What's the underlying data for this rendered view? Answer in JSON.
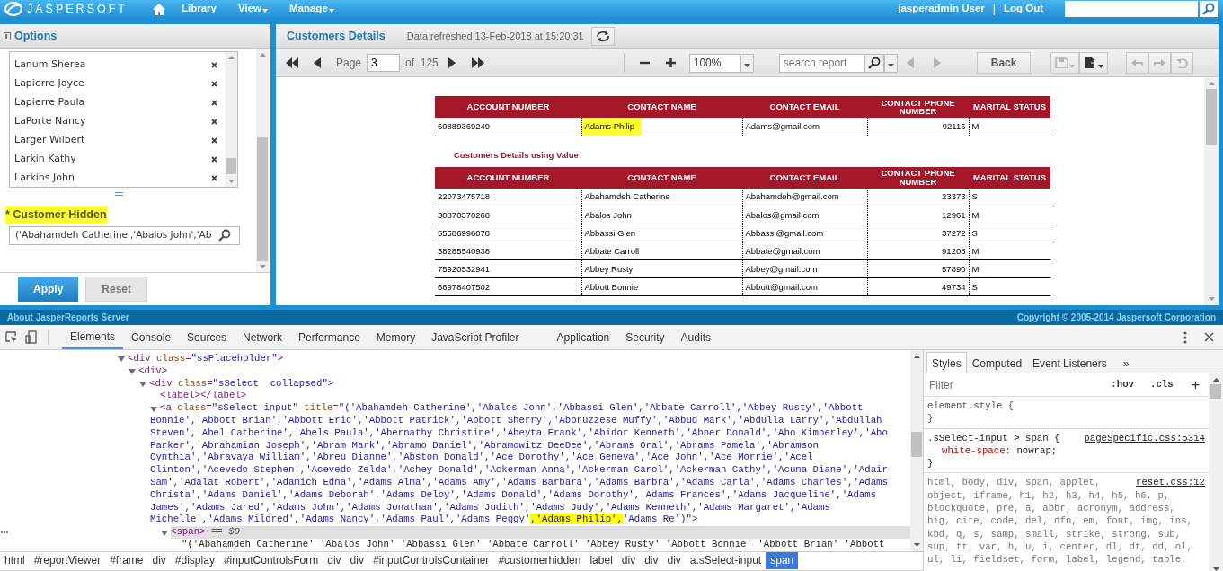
{
  "top_bar": {
    "brand": "JASPERSOFT",
    "menu": [
      {
        "label": "Library",
        "dropdown": false
      },
      {
        "label": "View",
        "dropdown": true
      },
      {
        "label": "Manage",
        "dropdown": true
      }
    ],
    "user": "jasperadmin User",
    "separator": "|",
    "logout": "Log Out"
  },
  "options_panel": {
    "title": "Options",
    "items": [
      "Lanum Sherea",
      "Lapierre Joyce",
      "Lapierre Paula",
      "LaPorte Nancy",
      "Larger Wilbert",
      "Larkin Kathy",
      "Larkins John"
    ],
    "field": {
      "required_mark": "*",
      "label": "Customer Hidden",
      "highlighted": true,
      "value": "('Abahamdeh Catherine','Abalos John','Ab"
    },
    "buttons": [
      {
        "label": "Apply",
        "kind": "primary"
      },
      {
        "label": "Reset",
        "kind": "secondary"
      }
    ]
  },
  "report": {
    "title": "Customers Details",
    "refreshed": "Data refreshed 13-Feb-2018 at 15:20:31",
    "toolbar": {
      "pager_back": [
        {
          "kind": "first",
          "disabled": false
        },
        {
          "kind": "prev",
          "disabled": false
        }
      ],
      "page_label": "Page",
      "page": "3",
      "of_label": "of",
      "page_count": "125",
      "pager_forward": [
        {
          "kind": "next",
          "disabled": false
        },
        {
          "kind": "last",
          "disabled": false
        }
      ],
      "zoom_buttons": [
        {
          "kind": "zoom-out",
          "disabled": false
        },
        {
          "kind": "zoom-in",
          "disabled": false
        }
      ],
      "zoom": "100%",
      "search_placeholder": "search report",
      "search_nav": [
        {
          "kind": "prev",
          "disabled": true
        },
        {
          "kind": "next",
          "disabled": true
        }
      ],
      "back": "Back",
      "file_buttons": [
        {
          "kind": "save",
          "disabled": true
        },
        {
          "kind": "export",
          "disabled": false
        }
      ],
      "history_buttons": [
        {
          "kind": "undo",
          "disabled": true
        },
        {
          "kind": "redo",
          "disabled": true
        },
        {
          "kind": "reset",
          "disabled": true
        }
      ]
    },
    "tables": [
      {
        "columns": [
          "ACCOUNT NUMBER",
          "CONTACT NAME",
          "CONTACT EMAIL",
          "CONTACT PHONE NUMBER",
          "MARITAL STATUS"
        ],
        "rows": [
          {
            "cells": [
              "60889369249",
              "Adams Philip",
              "Adams@gmail.com",
              "92116",
              "M"
            ],
            "name_highlighted": true
          }
        ]
      },
      {
        "caption": "Customers Details using Value",
        "columns": [
          "ACCOUNT NUMBER",
          "CONTACT NAME",
          "CONTACT EMAIL",
          "CONTACT PHONE NUMBER",
          "MARITAL STATUS"
        ],
        "rows": [
          {
            "cells": [
              "22073475718",
              "Abahamdeh Catherine",
              "Abahamdeh@gmail.com",
              "23373",
              "S"
            ],
            "name_highlighted": false
          },
          {
            "cells": [
              "30870370268",
              "Abalos John",
              "Abalos@gmail.com",
              "12961",
              "M"
            ],
            "name_highlighted": false
          },
          {
            "cells": [
              "55586996078",
              "Abbassi Glen",
              "Abbassi@gmail.com",
              "37272",
              "S"
            ],
            "name_highlighted": false
          },
          {
            "cells": [
              "38285540938",
              "Abbate Carroll",
              "Abbate@gmail.com",
              "91208",
              "M"
            ],
            "name_highlighted": false
          },
          {
            "cells": [
              "75920532941",
              "Abbey Rusty",
              "Abbey@gmail.com",
              "57890",
              "M"
            ],
            "name_highlighted": false
          },
          {
            "cells": [
              "66978407502",
              "Abbott Bonnie",
              "Abbott@gmail.com",
              "49734",
              "S"
            ],
            "name_highlighted": false
          }
        ]
      }
    ]
  },
  "footer": {
    "about": "About JasperReports Server",
    "copyright": "Copyright © 2005-2014 Jaspersoft Corporation"
  },
  "devtools": {
    "tabs": [
      {
        "label": "Elements",
        "selected": true
      },
      {
        "label": "Console",
        "selected": false
      },
      {
        "label": "Sources",
        "selected": false
      },
      {
        "label": "Network",
        "selected": false
      },
      {
        "label": "Performance",
        "selected": false
      },
      {
        "label": "Memory",
        "selected": false
      },
      {
        "label": "JavaScript Profiler",
        "selected": false
      },
      {
        "label": "Application",
        "selected": false
      },
      {
        "label": "Security",
        "selected": false
      },
      {
        "label": "Audits",
        "selected": false
      }
    ],
    "dom_tree": [
      {
        "expanded": true,
        "selected": false,
        "lines": [
          [
            {
              "kind": "tag",
              "text": "<div"
            },
            {
              "kind": "attr",
              "text": " class"
            },
            {
              "kind": "tag",
              "text": "="
            },
            {
              "kind": "value",
              "text": "\"ssPlaceholder\""
            },
            {
              "kind": "tag",
              "text": ">"
            }
          ]
        ],
        "children": [
          {
            "expanded": true,
            "selected": false,
            "lines": [
              [
                {
                  "kind": "tag",
                  "text": "<div>"
                }
              ]
            ],
            "children": [
              {
                "expanded": true,
                "selected": false,
                "lines": [
                  [
                    {
                      "kind": "tag",
                      "text": "<div"
                    },
                    {
                      "kind": "attr",
                      "text": " class"
                    },
                    {
                      "kind": "tag",
                      "text": "="
                    },
                    {
                      "kind": "value",
                      "text": "\"sSelect  collapsed\""
                    },
                    {
                      "kind": "tag",
                      "text": ">"
                    }
                  ]
                ],
                "children": [
                  {
                    "selected": false,
                    "lines": [
                      [
                        {
                          "kind": "tag",
                          "text": "<label></label>"
                        }
                      ]
                    ]
                  },
                  {
                    "expanded": true,
                    "selected": false,
                    "lines": [
                      [
                        {
                          "kind": "tag",
                          "text": "<a"
                        },
                        {
                          "kind": "attr",
                          "text": " class"
                        },
                        {
                          "kind": "tag",
                          "text": "="
                        },
                        {
                          "kind": "value",
                          "text": "\"sSelect-input\""
                        },
                        {
                          "kind": "attr",
                          "text": " title"
                        },
                        {
                          "kind": "tag",
                          "text": "="
                        },
                        {
                          "kind": "value",
                          "text": "\"('Abahamdeh Catherine','Abalos John','Abbassi Glen','Abbate Carroll','Abbey Rusty','Abbott"
                        }
                      ],
                      [
                        {
                          "kind": "value",
                          "text": "Bonnie','Abbott Brian','Abbott Eric','Abbott Patrick','Abbott Sherry','Abbruzzese Muffy','Abbud Mark','Abdulla Larry','Abdullah"
                        }
                      ],
                      [
                        {
                          "kind": "value",
                          "text": "Steven','Abel Catherine','Abels Paula','Abernathy Christine','Abeyta Frank','Abidor Kenneth','Abner Donald','Abo Kimberley','Abo"
                        }
                      ],
                      [
                        {
                          "kind": "value",
                          "text": "Parker','Abrahamian Joseph','Abram Mark','Abramo Daniel','Abramowitz DeeDee','Abrams Oral','Abrams Pamela','Abramson"
                        }
                      ],
                      [
                        {
                          "kind": "value",
                          "text": "Cynthia','Abravaya William','Abreu Dianne','Abston Donald','Ace Dorothy','Ace Geneva','Ace John','Ace Morrie','Acel"
                        }
                      ],
                      [
                        {
                          "kind": "value",
                          "text": "Clinton','Acevedo Stephen','Acevedo Zelda','Achey Donald','Ackerman Anna','Ackerman Carol','Ackerman Cathy','Acuna Diane','Adair"
                        }
                      ],
                      [
                        {
                          "kind": "value",
                          "text": "Sam','Adalat Robert','Adamich Edna','Adams Alma','Adams Amy','Adams Barbara','Adams Barbra','Adams Carla','Adams Charles','Adams"
                        }
                      ],
                      [
                        {
                          "kind": "value",
                          "text": "Christa','Adams Daniel','Adams Deborah','Adams Deloy','Adams Donald','Adams Dorothy','Adams Frances','Adams Jacqueline','Adams"
                        }
                      ],
                      [
                        {
                          "kind": "value",
                          "text": "James','Adams Jared','Adams John','Adams Jonathan','Adams Judith','Adams Judy','Adams Kenneth','Adams Margaret','Adams"
                        }
                      ],
                      [
                        {
                          "kind": "value",
                          "text": "Michelle','Adams Mildred','Adams Nancy','Adams Paul','Adams Peggy'"
                        },
                        {
                          "kind": "highlight",
                          "text": ",'Adams Philip',"
                        },
                        {
                          "kind": "value",
                          "text": "'Adams Re')\""
                        },
                        {
                          "kind": "tag",
                          "text": ">"
                        }
                      ]
                    ],
                    "children": [
                      {
                        "expanded": true,
                        "selected": true,
                        "lines": [
                          [
                            {
                              "kind": "tag",
                              "text": "<span>"
                            },
                            {
                              "kind": "plain",
                              "text": " == "
                            },
                            {
                              "kind": "italic",
                              "text": "$0"
                            }
                          ]
                        ],
                        "children": [
                          {
                            "selected": false,
                            "lines": [
                              [
                                {
                                  "kind": "text",
                                  "text": "\"('Abahamdeh Catherine' 'Abalos John' 'Abbassi Glen' 'Abbate Carroll' 'Abbey Rusty' 'Abbott Bonnie' 'Abbott Brian' 'Abbott"
                                }
                              ]
                            ]
                          }
                        ]
                      }
                    ]
                  }
                ]
              }
            ]
          }
        ]
      }
    ],
    "breadcrumbs": [
      {
        "label": "html",
        "selected": false
      },
      {
        "label": "#reportViewer",
        "selected": false
      },
      {
        "label": "#frame",
        "selected": false
      },
      {
        "label": "div",
        "selected": false
      },
      {
        "label": "#display",
        "selected": false
      },
      {
        "label": "#inputControlsForm",
        "selected": false
      },
      {
        "label": "div",
        "selected": false
      },
      {
        "label": "div",
        "selected": false
      },
      {
        "label": "#inputControlsContainer",
        "selected": false
      },
      {
        "label": "#customerhidden",
        "selected": false
      },
      {
        "label": "label",
        "selected": false
      },
      {
        "label": "div",
        "selected": false
      },
      {
        "label": "div",
        "selected": false
      },
      {
        "label": "div",
        "selected": false
      },
      {
        "label": "a.sSelect-input",
        "selected": false
      },
      {
        "label": "span",
        "selected": true
      }
    ],
    "styles_tabs": [
      {
        "label": "Styles",
        "selected": true
      },
      {
        "label": "Computed",
        "selected": false
      },
      {
        "label": "Event Listeners",
        "selected": false
      }
    ],
    "more_tabs": "»",
    "filter_placeholder": "Filter",
    "hov": ":hov",
    "cls": ".cls",
    "add": "+",
    "rules": [
      {
        "selector": "element.style {",
        "closing": "}"
      },
      {
        "selector": ".sSelect-input > span {",
        "source": "pageSpecific.css:5314",
        "declarations": [
          {
            "property": "white-space:",
            "value": "nowrap;"
          }
        ],
        "closing": "}"
      },
      {
        "selector": "html, body, div, span, applet,",
        "source": "reset.css:12",
        "selector_more": [
          "object, iframe, h1, h2, h3, h4, h5, h6, p,",
          "blockquote, pre, a, abbr, acronym, address,",
          "big, cite, code, del, dfn, em, font, img, ins,",
          "kbd, q, s, samp, small, strike, strong, sub,",
          "sup, tt, var, b, u, i, center, dl, dt, dd, ol,",
          "ul, li, fieldset, form, label, legend, table,"
        ]
      }
    ]
  }
}
